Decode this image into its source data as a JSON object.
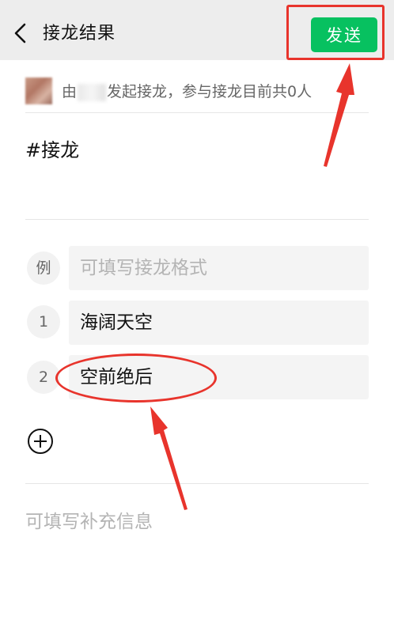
{
  "nav": {
    "title": "接龙结果",
    "send_label": "发送"
  },
  "initiator": {
    "prefix": "由",
    "suffix": "发起接龙，参与接龙目前共0人"
  },
  "topic": "#接龙",
  "entries": [
    {
      "num": "例",
      "text": "可填写接龙格式",
      "placeholder": true
    },
    {
      "num": "1",
      "text": "海阔天空",
      "placeholder": false
    },
    {
      "num": "2",
      "text": "空前绝后",
      "placeholder": false
    }
  ],
  "extra_placeholder": "可填写补充信息",
  "colors": {
    "accent_green": "#07c160",
    "annotation_red": "#e8342c",
    "nav_background": "#ededed"
  },
  "icons": {
    "back": "chevron-left-icon",
    "add": "plus-circle-icon"
  }
}
